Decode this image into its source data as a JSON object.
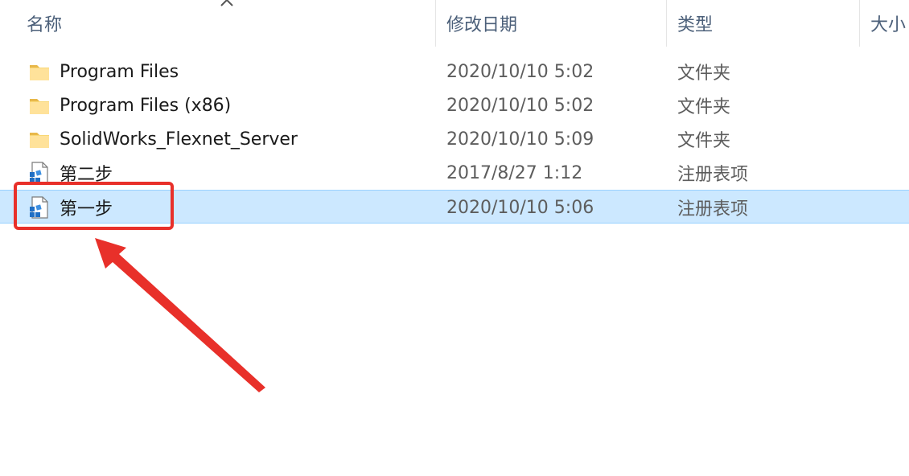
{
  "columns": {
    "name": "名称",
    "date": "修改日期",
    "type": "类型",
    "size": "大小"
  },
  "rows": [
    {
      "name": "Program Files",
      "date": "2020/10/10 5:02",
      "type": "文件夹",
      "icon": "folder-icon"
    },
    {
      "name": "Program Files (x86)",
      "date": "2020/10/10 5:02",
      "type": "文件夹",
      "icon": "folder-icon"
    },
    {
      "name": "SolidWorks_Flexnet_Server",
      "date": "2020/10/10 5:09",
      "type": "文件夹",
      "icon": "folder-icon"
    },
    {
      "name": "第二步",
      "date": "2017/8/27 1:12",
      "type": "注册表项",
      "icon": "registry-file-icon"
    },
    {
      "name": "第一步",
      "date": "2020/10/10 5:06",
      "type": "注册表项",
      "icon": "registry-file-icon",
      "selected": true
    }
  ],
  "colors": {
    "selection": "#cce8ff",
    "annotation": "#e8302a",
    "folder": "#f8d775"
  }
}
